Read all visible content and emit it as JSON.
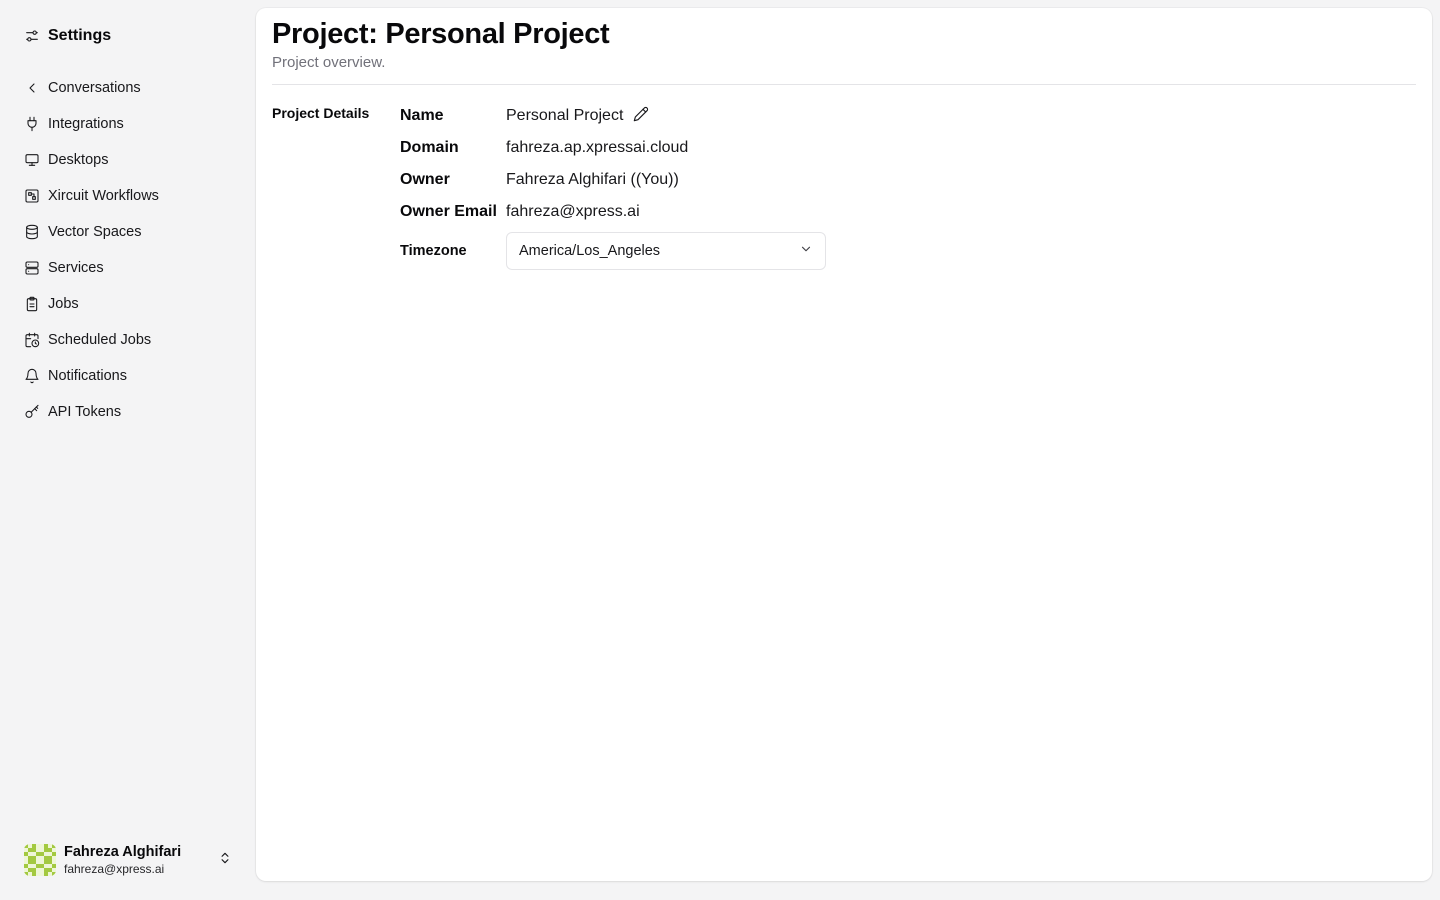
{
  "sidebar": {
    "title": "Settings",
    "header_icon": "settings-sliders-icon",
    "items": [
      {
        "label": "Conversations",
        "icon": "chevron-left-icon"
      },
      {
        "label": "Integrations",
        "icon": "plug-icon"
      },
      {
        "label": "Desktops",
        "icon": "monitor-icon"
      },
      {
        "label": "Xircuit Workflows",
        "icon": "workflow-icon"
      },
      {
        "label": "Vector Spaces",
        "icon": "database-icon"
      },
      {
        "label": "Services",
        "icon": "server-icon"
      },
      {
        "label": "Jobs",
        "icon": "clipboard-icon"
      },
      {
        "label": "Scheduled Jobs",
        "icon": "calendar-clock-icon"
      },
      {
        "label": "Notifications",
        "icon": "bell-icon"
      },
      {
        "label": "API Tokens",
        "icon": "key-icon"
      }
    ],
    "user": {
      "name": "Fahreza Alghifari",
      "email": "fahreza@xpress.ai"
    }
  },
  "main": {
    "title": "Project: Personal Project",
    "subtitle": "Project overview.",
    "section_label": "Project Details",
    "details": {
      "name_label": "Name",
      "name_value": "Personal Project",
      "domain_label": "Domain",
      "domain_value": "fahreza.ap.xpressai.cloud",
      "owner_label": "Owner",
      "owner_value": "Fahreza Alghifari ((You))",
      "owner_email_label": "Owner Email",
      "owner_email_value": "fahreza@xpress.ai",
      "timezone_label": "Timezone",
      "timezone_value": "America/Los_Angeles"
    }
  },
  "colors": {
    "sidebar_bg": "#f4f4f5",
    "panel_bg": "#ffffff",
    "muted_text": "#71717a",
    "avatar_accent": "#a3c940"
  }
}
